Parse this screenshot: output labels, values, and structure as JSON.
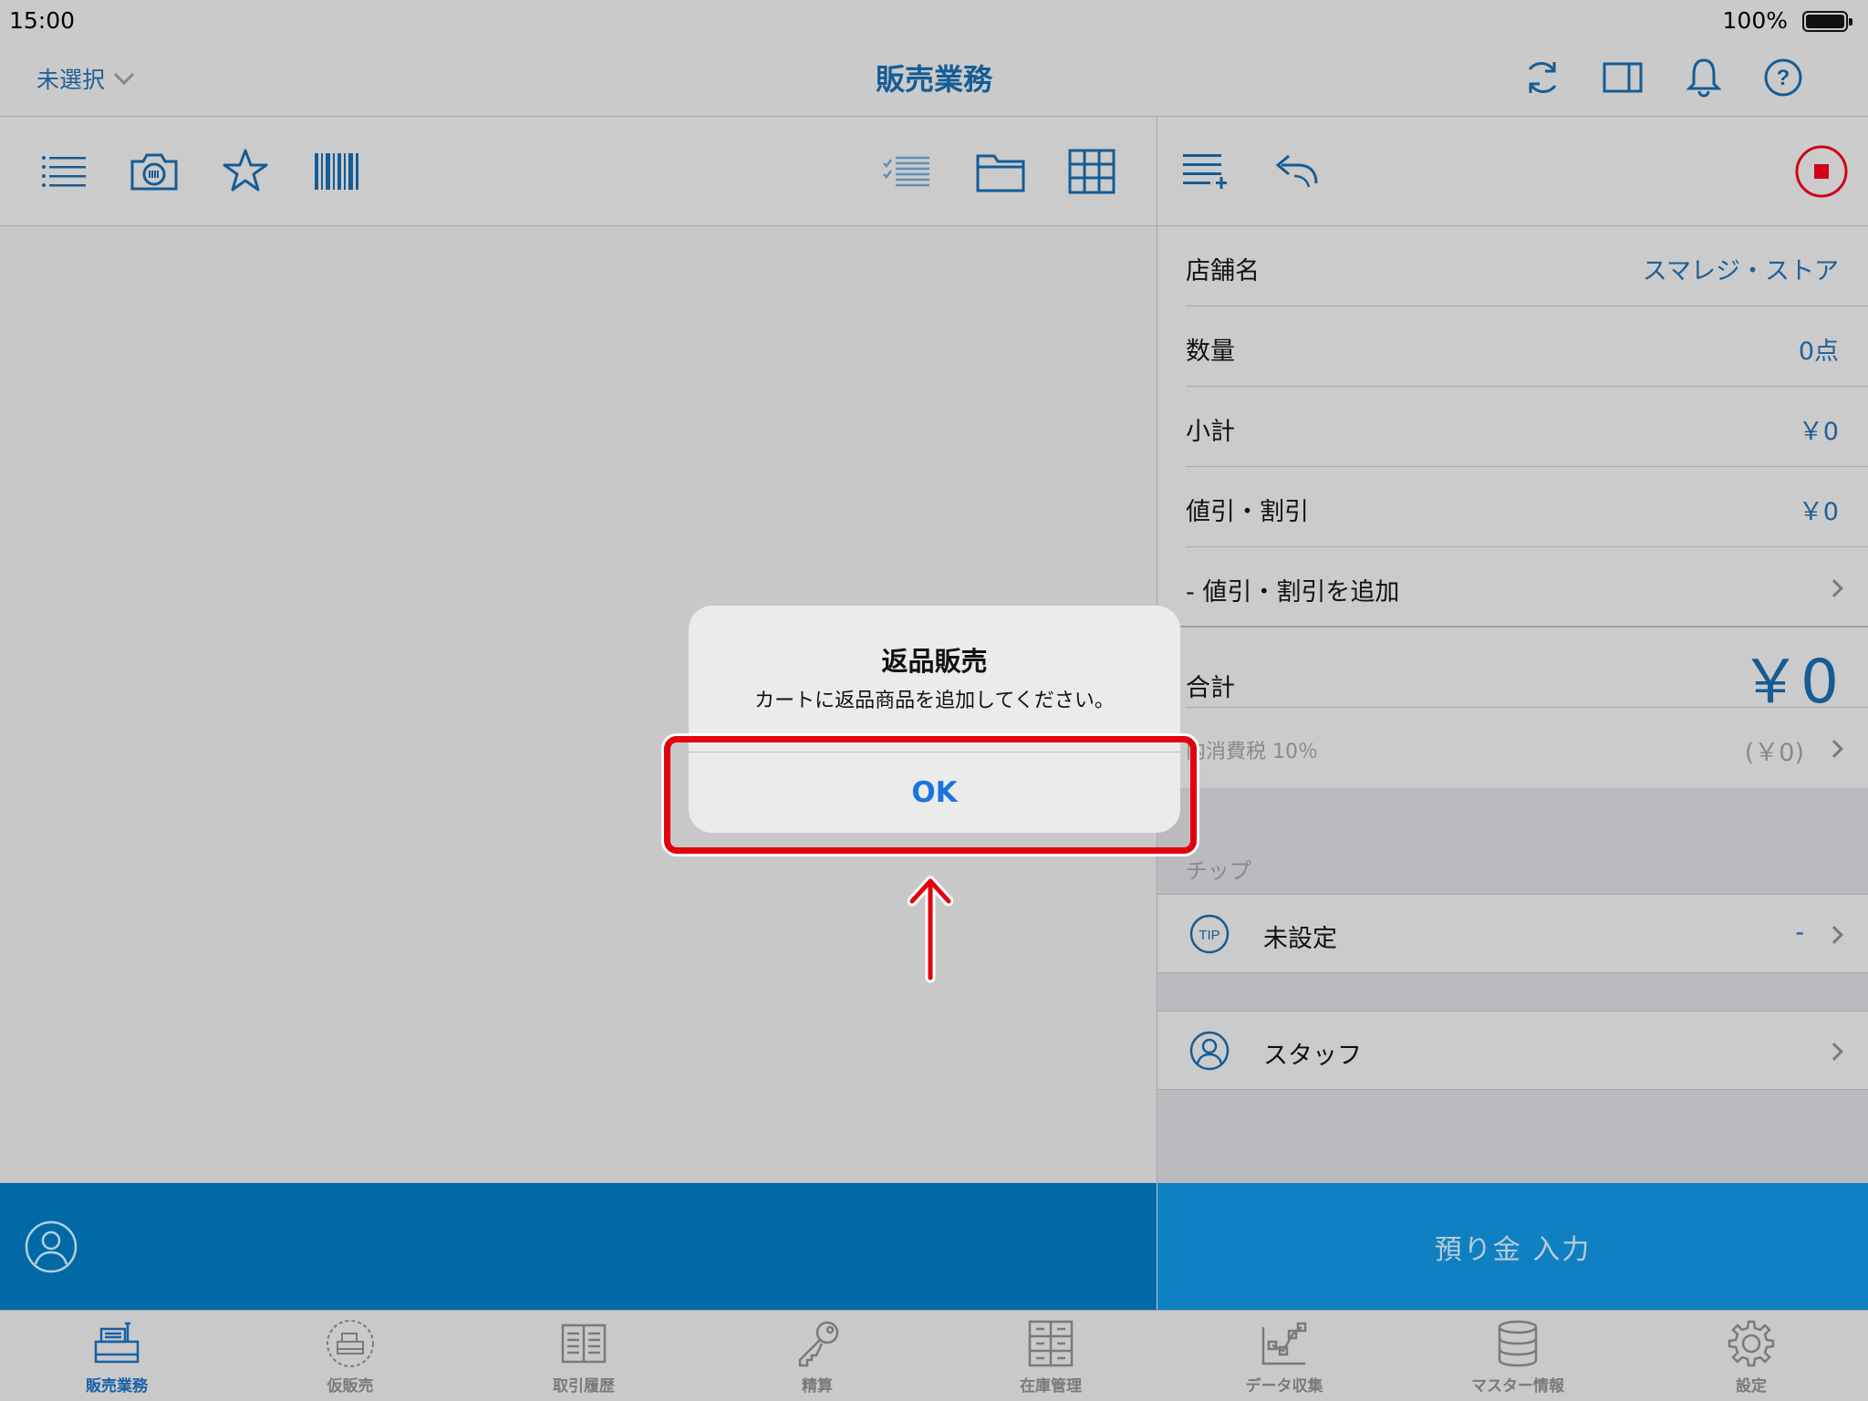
{
  "status_bar": {
    "time": "15:00",
    "battery": "100%"
  },
  "nav": {
    "store_select": "未選択",
    "title": "販売業務",
    "icons": [
      "refresh-icon",
      "split-view-icon",
      "bell-icon",
      "help-icon"
    ]
  },
  "left_toolbar": {
    "icons": [
      "list-icon",
      "camera-icon",
      "star-icon",
      "barcode-icon",
      "checklist-icon",
      "folder-icon",
      "grid-icon"
    ]
  },
  "right_toolbar": {
    "icons": [
      "add-line-icon",
      "return-icon",
      "stop-record-icon"
    ]
  },
  "summary": {
    "store_label": "店舗名",
    "store_value": "スマレジ・ストア",
    "qty_label": "数量",
    "qty_value": "0点",
    "subtotal_label": "小計",
    "subtotal_value": "￥0",
    "discount_label": "値引・割引",
    "discount_value": "￥0",
    "add_discount_label": "- 値引・割引を追加",
    "total_label": "合計",
    "total_value": "￥0",
    "tax_label": "内消費税 10％",
    "tax_value": "(￥0)"
  },
  "tip": {
    "section_label": "チップ",
    "value_label": "未設定",
    "value": "-"
  },
  "staff": {
    "label": "スタッフ"
  },
  "actions": {
    "deposit_label": "預り金 入力"
  },
  "tabs": [
    {
      "label": "販売業務",
      "icon": "register-icon",
      "active": true
    },
    {
      "label": "仮販売",
      "icon": "temp-sale-icon",
      "active": false
    },
    {
      "label": "取引履歴",
      "icon": "history-icon",
      "active": false
    },
    {
      "label": "精算",
      "icon": "key-icon",
      "active": false
    },
    {
      "label": "在庫管理",
      "icon": "inventory-icon",
      "active": false
    },
    {
      "label": "データ収集",
      "icon": "data-collection-icon",
      "active": false
    },
    {
      "label": "マスター情報",
      "icon": "database-icon",
      "active": false
    },
    {
      "label": "設定",
      "icon": "gear-icon",
      "active": false
    }
  ],
  "alert": {
    "title": "返品販売",
    "message": "カートに返品商品を追加してください。",
    "ok_label": "OK"
  },
  "colors": {
    "accent": "#155c95",
    "action_bar_left": "#016aa6",
    "action_bar_right": "#0f80c2",
    "alert_button": "#1a74df",
    "highlight": "#e3000f",
    "record_stop": "#d0021b"
  }
}
